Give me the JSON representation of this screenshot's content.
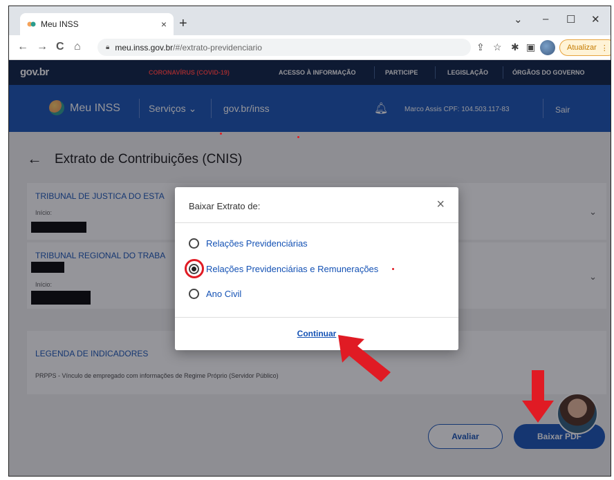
{
  "browser": {
    "tab_title": "Meu INSS",
    "tab_close": "×",
    "new_tab": "+",
    "win_chevron": "⌄",
    "win_min": "–",
    "win_max": "☐",
    "win_close": "✕",
    "nav_back": "←",
    "nav_forward": "→",
    "nav_reload": "C",
    "nav_home": "⌂",
    "url_host": "meu.inss.gov.br",
    "url_path": "/#/extrato-previdenciario",
    "update_label": "Atualizar"
  },
  "govbar": {
    "logo": "gov.br",
    "covid": "CORONAVÍRUS (COVID-19)",
    "items": [
      "ACESSO À INFORMAÇÃO",
      "PARTICIPE",
      "LEGISLAÇÃO",
      "ÓRGÃOS DO GOVERNO"
    ]
  },
  "inss": {
    "title": "Meu INSS",
    "menu_servicos": "Serviços ⌄",
    "menu_govbr": "gov.br/inss",
    "user": "Marco Assis  CPF: 104.503.117-83",
    "logout": "Sair"
  },
  "page": {
    "title": "Extrato de Contribuições (CNIS)",
    "cards": [
      {
        "title": "TRIBUNAL DE JUSTICA DO ESTA",
        "label": "Início:"
      },
      {
        "title": "TRIBUNAL REGIONAL DO TRABA",
        "label": "Início:"
      }
    ],
    "legend_title": "LEGENDA DE INDICADORES",
    "legend_text": "PRPPS - Vínculo de empregado com informações de Regime Próprio (Servidor Público)",
    "btn_avaliar": "Avaliar",
    "btn_baixar": "Baixar PDF"
  },
  "modal": {
    "title": "Baixar Extrato de:",
    "close": "×",
    "options": [
      {
        "label": "Relações Previdenciárias",
        "selected": false
      },
      {
        "label": "Relações Previdenciárias e Remunerações",
        "selected": true
      },
      {
        "label": "Ano Civil",
        "selected": false
      }
    ],
    "continue_label": "Continuar"
  },
  "colors": {
    "gov_dark": "#071d41",
    "inss_blue": "#1351b4",
    "annotation_red": "#e01b24"
  }
}
